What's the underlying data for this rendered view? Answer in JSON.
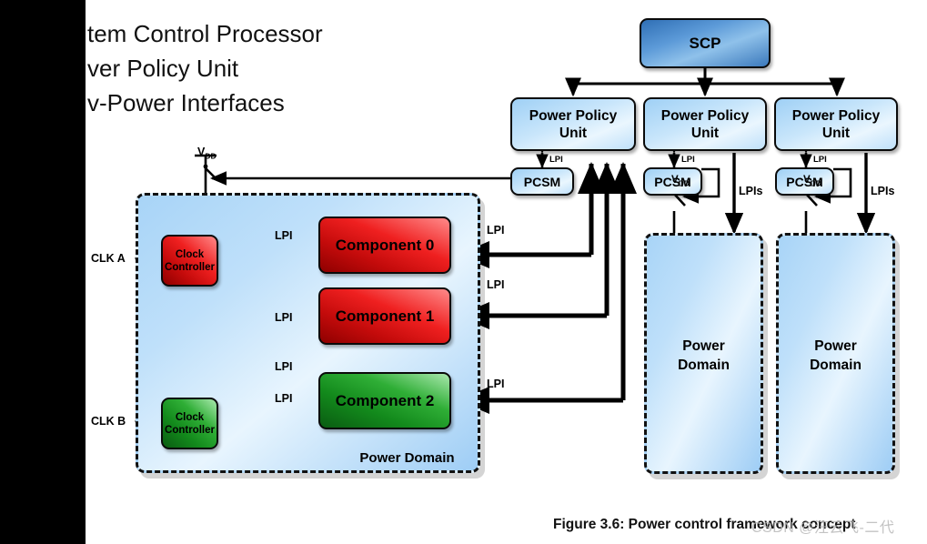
{
  "title": {
    "line1": "System Control Processor",
    "line2": "Power Policy Unit",
    "line3": "Low-Power Interfaces",
    "visible_text": "tem Control Processor\nver Policy Unit\nv-Power Interfaces"
  },
  "caption": {
    "text": "Figure 3.6: Power control framework concept",
    "watermark": "CSDN @汪云飞-二代"
  },
  "colors": {
    "scp_blue": "#3b79bc",
    "box_blue": "#9fd0f5",
    "component_red": "#c40b0b",
    "component_green": "#138a1c",
    "power_domain_fill": "#bfe0fa",
    "wire_black": "#000000",
    "wire_gray": "#8d8d8d",
    "watermark_gray": "#b9b9b9",
    "band_black": "#000000"
  },
  "scp": {
    "label": "SCP"
  },
  "policy_units": [
    {
      "id": "ppu-0",
      "label": "Power Policy\nUnit",
      "line1": "Power Policy",
      "line2": "Unit"
    },
    {
      "id": "ppu-1",
      "label": "Power Policy\nUnit",
      "line1": "Power Policy",
      "line2": "Unit"
    },
    {
      "id": "ppu-2",
      "label": "Power Policy\nUnit",
      "line1": "Power Policy",
      "line2": "Unit"
    }
  ],
  "pcsm": [
    {
      "id": "pcsm-0",
      "label": "PCSM"
    },
    {
      "id": "pcsm-1",
      "label": "PCSM"
    },
    {
      "id": "pcsm-2",
      "label": "PCSM"
    }
  ],
  "left_domain": {
    "label_line1": "Power",
    "label_line2": "Domain",
    "label": "Power Domain",
    "clock_controllers": [
      {
        "id": "clock-controller-a",
        "line1": "Clock",
        "line2": "Controller",
        "color": "red"
      },
      {
        "id": "clock-controller-b",
        "line1": "Clock",
        "line2": "Controller",
        "color": "green"
      }
    ],
    "components": [
      {
        "id": "component-0",
        "label": "Component 0",
        "color": "red"
      },
      {
        "id": "component-1",
        "label": "Component 1",
        "color": "red"
      },
      {
        "id": "component-2",
        "label": "Component 2",
        "color": "green"
      }
    ]
  },
  "right_domains": [
    {
      "id": "power-domain-1",
      "line1": "Power",
      "line2": "Domain"
    },
    {
      "id": "power-domain-2",
      "line1": "Power",
      "line2": "Domain"
    }
  ],
  "signal_labels": {
    "clk_a": "CLK A",
    "clk_b": "CLK B",
    "vdd": "V",
    "vdd_sub": "DD",
    "lpi": "LPI",
    "lpis": "LPIs"
  },
  "lpi_labels": {
    "ppu_pcsm_0": "LPI",
    "ppu_pcsm_1": "LPI",
    "ppu_pcsm_2": "LPI",
    "cc_comp0": "LPI",
    "cc_comp1": "LPI",
    "cc_comp2a": "LPI",
    "cc_comp2b": "LPI",
    "domain_comp0": "LPI",
    "domain_comp1": "LPI",
    "domain_comp2": "LPI",
    "lpis_1": "LPIs",
    "lpis_2": "LPIs"
  },
  "vdd_labels": {
    "left": "VDD",
    "mid": "VDD",
    "right": "VDD"
  }
}
